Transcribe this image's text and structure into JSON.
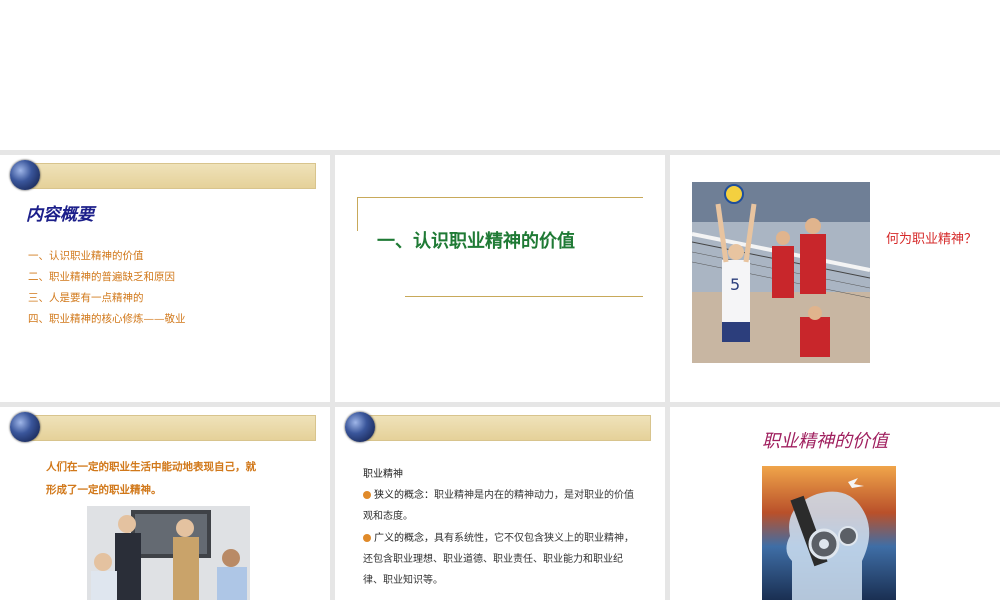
{
  "slide1": {
    "title": "内容概要",
    "items": [
      "一、认识职业精神的价值",
      "二、职业精神的普遍缺乏和原因",
      "三、人是要有一点精神的",
      "四、职业精神的核心修炼——敬业"
    ]
  },
  "slide2": {
    "section_title": "一、认识职业精神的价值"
  },
  "slide3": {
    "question": "何为职业精神？",
    "jersey_number": "5"
  },
  "slide4": {
    "quote_line1": "人们在一定的职业生活中能动地表现自己，就",
    "quote_line2": "形成了一定的职业精神。"
  },
  "slide5": {
    "heading": "职业精神",
    "bullet1_term": "狭义的概念：",
    "bullet1_text": "职业精神是内在的精神动力，是对职业的价值观和态度。",
    "bullet2_term": "广义的概念，",
    "bullet2_text": "具有系统性，它不仅包含狭义上的职业精神，还包含职业理想、职业道德、职业责任、职业能力和职业纪律、职业知识等。"
  },
  "slide6": {
    "title": "职业精神的价值"
  },
  "colors": {
    "accent_orange": "#d1781a",
    "title_blue": "#1c1f8a",
    "section_green": "#1f7a35",
    "question_red": "#d62b2b",
    "value_magenta": "#a0205f"
  },
  "icons": [
    "globe-icon",
    "bullet-icon"
  ]
}
